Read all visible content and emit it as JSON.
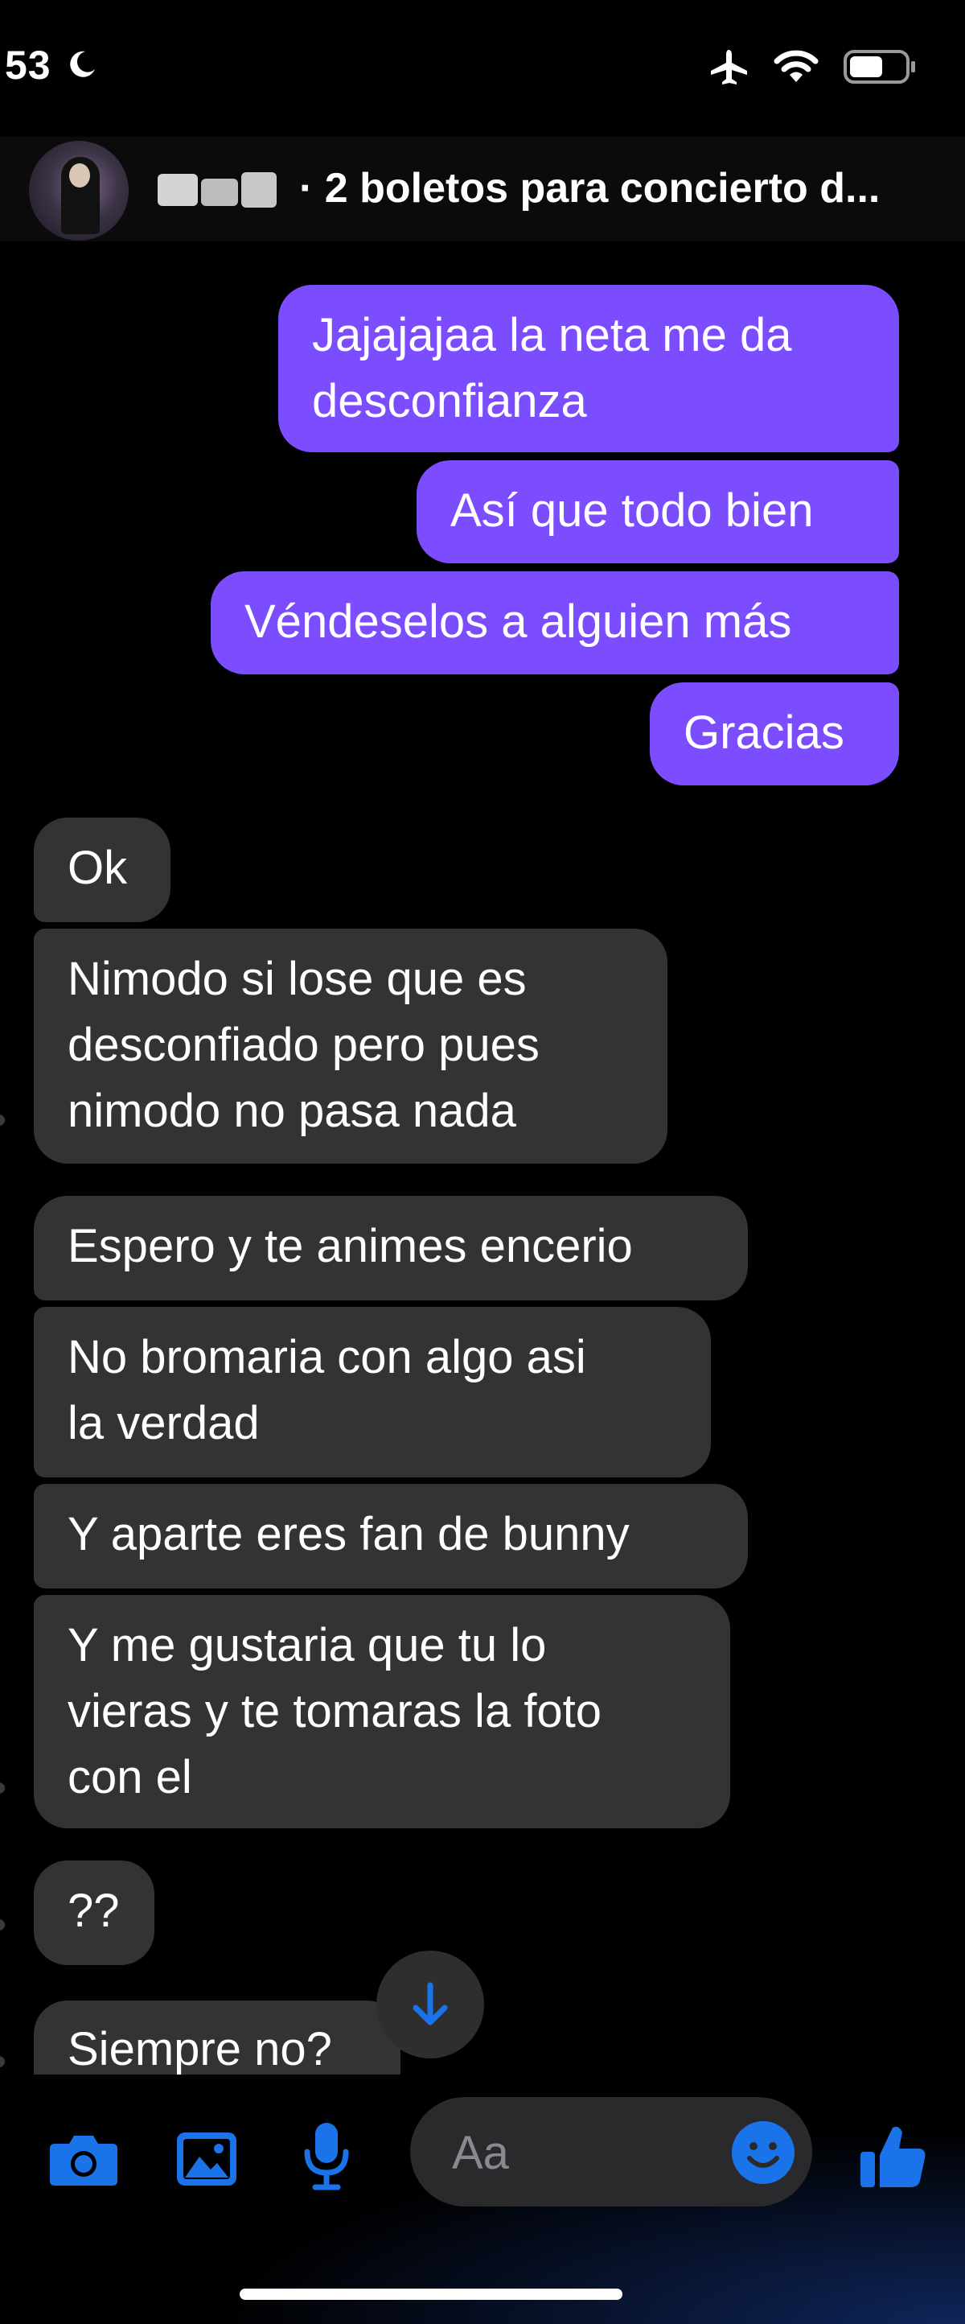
{
  "status_bar": {
    "time": "53"
  },
  "header": {
    "title": "· 2 boletos para concierto d..."
  },
  "messages": [
    {
      "from": "me",
      "text": "Jajajajaa la neta me da\ndesconfianza"
    },
    {
      "from": "me",
      "text": "Así que todo bien"
    },
    {
      "from": "me",
      "text": "Véndeselos a alguien más"
    },
    {
      "from": "me",
      "text": "Gracias"
    },
    {
      "from": "them",
      "text": "Ok"
    },
    {
      "from": "them",
      "text": "Nimodo si lose que es\ndesconfiado pero pues\nnimodo no pasa nada"
    },
    {
      "from": "them",
      "text": "Espero y te animes encerio"
    },
    {
      "from": "them",
      "text": "No bromaria con algo asi\nla verdad"
    },
    {
      "from": "them",
      "text": "Y aparte eres fan de bunny"
    },
    {
      "from": "them",
      "text": "Y me gustaria que tu lo\nvieras y te tomaras la foto\ncon el"
    },
    {
      "from": "them",
      "text": "??"
    },
    {
      "from": "them",
      "text": "Siempre no?"
    }
  ],
  "composer": {
    "placeholder": "Aa"
  },
  "colors": {
    "outgoing_bubble": "#7c4dff",
    "incoming_bubble": "#333335",
    "accent": "#1a73e8"
  },
  "icons": [
    "moon-icon",
    "airplane-icon",
    "wifi-icon",
    "battery-icon",
    "camera-icon",
    "image-icon",
    "microphone-icon",
    "emoji-icon",
    "thumbs-up-icon",
    "arrow-down-icon"
  ]
}
